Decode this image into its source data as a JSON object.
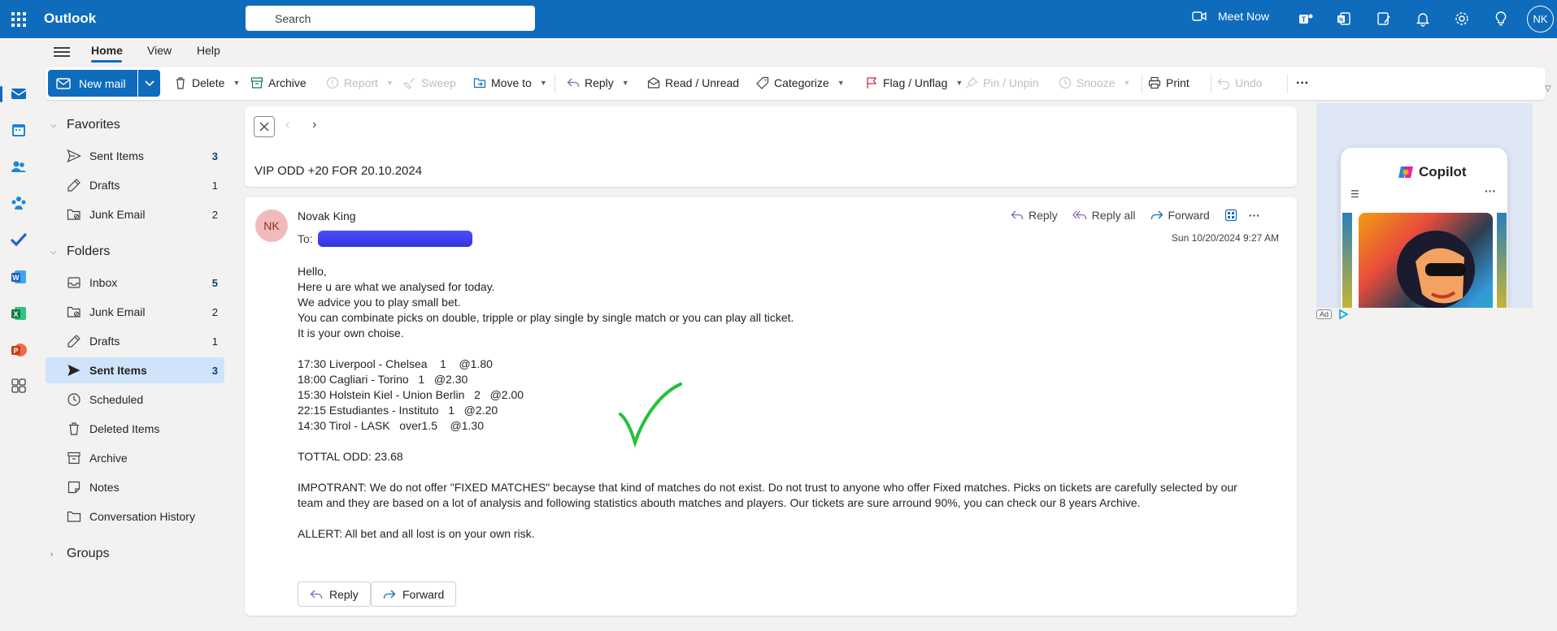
{
  "app": {
    "name": "Outlook",
    "search_placeholder": "Search",
    "meet_now": "Meet Now",
    "user_initials": "NK"
  },
  "tabs": [
    "Home",
    "View",
    "Help"
  ],
  "toolbar": {
    "new_mail": "New mail",
    "delete": "Delete",
    "archive": "Archive",
    "report": "Report",
    "sweep": "Sweep",
    "move_to": "Move to",
    "reply": "Reply",
    "read_unread": "Read / Unread",
    "categorize": "Categorize",
    "flag_unflag": "Flag / Unflag",
    "pin_unpin": "Pin / Unpin",
    "snooze": "Snooze",
    "print": "Print",
    "undo": "Undo",
    "more": "···"
  },
  "favorites": {
    "title": "Favorites",
    "items": [
      {
        "label": "Sent Items",
        "count": "3"
      },
      {
        "label": "Drafts",
        "count": "1"
      },
      {
        "label": "Junk Email",
        "count": "2"
      }
    ]
  },
  "folders": {
    "title": "Folders",
    "items": [
      {
        "label": "Inbox",
        "count": "5"
      },
      {
        "label": "Junk Email",
        "count": "2"
      },
      {
        "label": "Drafts",
        "count": "1"
      },
      {
        "label": "Sent Items",
        "count": "3"
      },
      {
        "label": "Scheduled",
        "count": ""
      },
      {
        "label": "Deleted Items",
        "count": ""
      },
      {
        "label": "Archive",
        "count": ""
      },
      {
        "label": "Notes",
        "count": ""
      },
      {
        "label": "Conversation History",
        "count": ""
      }
    ]
  },
  "groups": {
    "title": "Groups"
  },
  "message": {
    "subject": "VIP ODD +20 FOR 20.10.2024",
    "sender_initials": "NK",
    "sender_name": "Novak King",
    "to_label": "To:",
    "date": "Sun 10/20/2024 9:27 AM",
    "actions": {
      "reply": "Reply",
      "reply_all": "Reply all",
      "forward": "Forward"
    },
    "body": {
      "intro": [
        "Hello,",
        "Here u are what we analysed for today.",
        "We advice you to play small bet.",
        "You can combinate picks on double, tripple or play single by single match or you can play all ticket.",
        "It is your own choise."
      ],
      "picks": [
        "17:30 Liverpool - Chelsea    1    @1.80",
        "18:00 Cagliari - Torino   1   @2.30",
        "15:30 Holstein Kiel - Union Berlin   2   @2.00",
        "22:15 Estudiantes - Instituto   1   @2.20",
        "14:30 Tirol - LASK   over1.5    @1.30"
      ],
      "total": "TOTTAL ODD: 23.68",
      "important": "IMPOTRANT: We do not offer \"FIXED MATCHES\" becayse that kind of matches do not exist. Do not trust to anyone who offer Fixed matches. Picks on tickets are carefully selected by our team and they are based on a lot of analysis and following statistics abouth matches and players. Our tickets are sure arround 90%, you can check our 8 years Archive.",
      "allert": "ALLERT: All bet and all lost is on your own risk."
    },
    "footer": {
      "reply": "Reply",
      "forward": "Forward"
    }
  },
  "ad": {
    "title": "Copilot",
    "badge": "Ad"
  },
  "colors": {
    "brand": "#0f6cbd",
    "selected": "#cfe4fa",
    "checkmark": "#22c23a"
  }
}
